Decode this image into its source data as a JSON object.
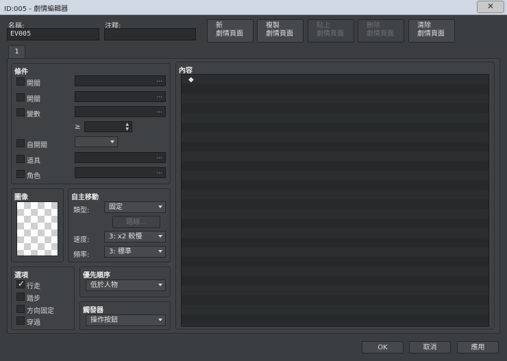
{
  "window": {
    "title": "ID:005 - 劇情編輯器",
    "close_label": "✕"
  },
  "header": {
    "name_label": "名稱:",
    "name_value": "EV005",
    "note_label": "注釋:",
    "note_value": "",
    "buttons": [
      {
        "line1": "新",
        "line2": "劇情頁面",
        "enabled": true
      },
      {
        "line1": "複製",
        "line2": "劇情頁面",
        "enabled": true
      },
      {
        "line1": "貼上",
        "line2": "劇情頁面",
        "enabled": false
      },
      {
        "line1": "刪除",
        "line2": "劇情頁面",
        "enabled": false
      },
      {
        "line1": "清除",
        "line2": "劇情頁面",
        "enabled": true
      }
    ]
  },
  "tabs": [
    {
      "label": "1"
    }
  ],
  "conditions": {
    "title": "條件",
    "switch1_label": "開關",
    "switch2_label": "開關",
    "variable_label": "變數",
    "gte_symbol": "≥",
    "self_switch_label": "自開關",
    "item_label": "道具",
    "actor_label": "角色",
    "dots": "..."
  },
  "image": {
    "title": "圖像"
  },
  "autonomous": {
    "title": "自主移動",
    "type_label": "類型:",
    "type_value": "固定",
    "route_button": "路線...",
    "speed_label": "速度:",
    "speed_value": "3: x2 較慢",
    "freq_label": "頻率:",
    "freq_value": "3: 標準"
  },
  "options": {
    "title": "選項",
    "items": [
      {
        "label": "行走",
        "checked": true
      },
      {
        "label": "踏步",
        "checked": false
      },
      {
        "label": "方向固定",
        "checked": false
      },
      {
        "label": "穿過",
        "checked": false
      }
    ]
  },
  "priority": {
    "title": "優先順序",
    "value": "低於人物"
  },
  "trigger": {
    "title": "觸發器",
    "value": "操作按鈕"
  },
  "contents": {
    "title": "內容",
    "first_row_marker": "◆"
  },
  "footer": {
    "ok": "OK",
    "cancel": "取消",
    "apply": "應用"
  },
  "colors": {
    "list_row_a": "#2b2e2f",
    "list_row_b": "#262829"
  }
}
